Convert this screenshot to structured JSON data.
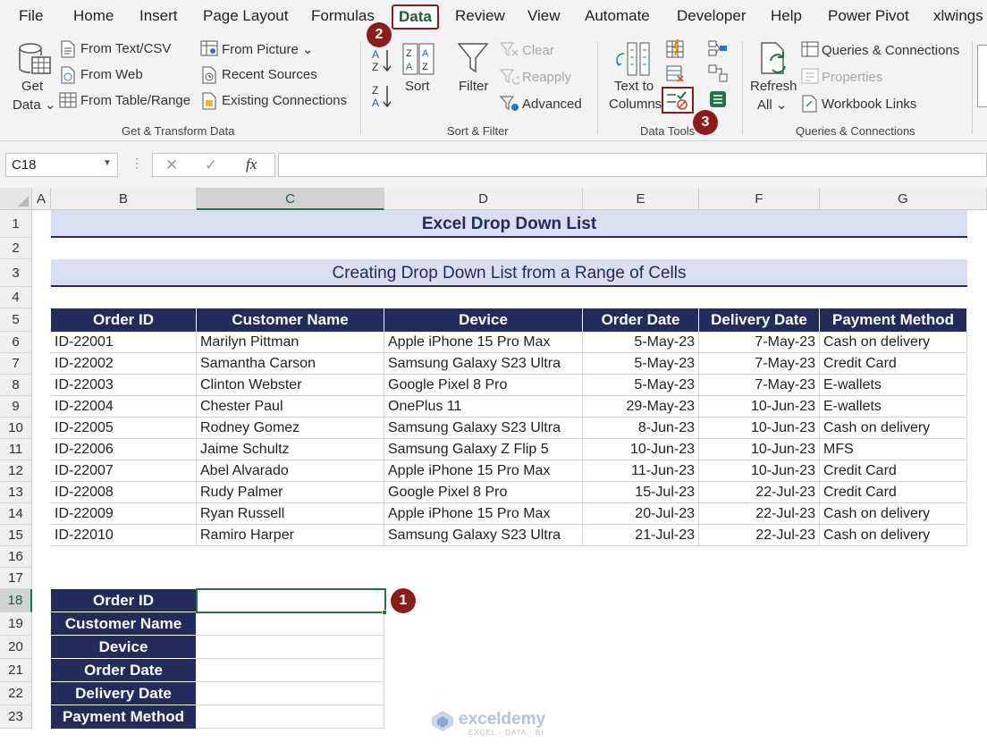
{
  "menu": [
    "File",
    "Home",
    "Insert",
    "Page Layout",
    "Formulas",
    "Data",
    "Review",
    "View",
    "Automate",
    "Developer",
    "Help",
    "Power Pivot",
    "xlwings"
  ],
  "ribbon": {
    "get_data": [
      "Get",
      "Data ⌄"
    ],
    "from_text_csv": "From Text/CSV",
    "from_web": "From Web",
    "from_table_range": "From Table/Range",
    "from_picture": "From Picture ⌄",
    "recent_sources": "Recent Sources",
    "existing_connections": "Existing Connections",
    "group_get_transform": "Get & Transform Data",
    "sort": "Sort",
    "filter": "Filter",
    "clear": "Clear",
    "reapply": "Reapply",
    "advanced": "Advanced",
    "group_sort_filter": "Sort & Filter",
    "text_to_columns": [
      "Text to",
      "Columns"
    ],
    "group_data_tools": "Data Tools",
    "refresh_all": [
      "Refresh",
      "All ⌄"
    ],
    "queries_connections": "Queries & Connections",
    "properties": "Properties",
    "workbook_links": "Workbook Links",
    "group_queries_connections": "Queries & Connections"
  },
  "formula_bar": {
    "name_box": "C18",
    "cancel": "✕",
    "enter": "✓",
    "fx": "fx",
    "value": ""
  },
  "columns": [
    "A",
    "B",
    "C",
    "D",
    "E",
    "F",
    "G"
  ],
  "rows": [
    "1",
    "2",
    "3",
    "4",
    "5",
    "6",
    "7",
    "8",
    "9",
    "10",
    "11",
    "12",
    "13",
    "14",
    "15",
    "16",
    "17",
    "18",
    "19",
    "20",
    "21",
    "22",
    "23"
  ],
  "sheet": {
    "title": "Excel Drop Down List",
    "subtitle": "Creating Drop Down List from a Range of Cells",
    "headers": [
      "Order ID",
      "Customer Name",
      "Device",
      "Order Date",
      "Delivery Date",
      "Payment Method"
    ],
    "data": [
      [
        "ID-22001",
        "Marilyn Pittman",
        "Apple iPhone 15 Pro Max",
        "5-May-23",
        "7-May-23",
        "Cash on delivery"
      ],
      [
        "ID-22002",
        "Samantha Carson",
        "Samsung Galaxy S23 Ultra",
        "5-May-23",
        "7-May-23",
        "Credit Card"
      ],
      [
        "ID-22003",
        "Clinton Webster",
        "Google Pixel 8 Pro",
        "5-May-23",
        "7-May-23",
        "E-wallets"
      ],
      [
        "ID-22004",
        "Chester Paul",
        "OnePlus 11",
        "29-May-23",
        "10-Jun-23",
        "E-wallets"
      ],
      [
        "ID-22005",
        "Rodney Gomez",
        "Samsung Galaxy S23 Ultra",
        "8-Jun-23",
        "10-Jun-23",
        "Cash on delivery"
      ],
      [
        "ID-22006",
        "Jaime Schultz",
        "Samsung Galaxy Z Flip 5",
        "10-Jun-23",
        "10-Jun-23",
        "MFS"
      ],
      [
        "ID-22007",
        "Abel Alvarado",
        "Apple iPhone 15 Pro Max",
        "11-Jun-23",
        "10-Jun-23",
        "Credit Card"
      ],
      [
        "ID-22008",
        "Rudy Palmer",
        "Google Pixel 8 Pro",
        "15-Jul-23",
        "22-Jul-23",
        "Credit Card"
      ],
      [
        "ID-22009",
        "Ryan Russell",
        "Apple iPhone 15 Pro Max",
        "20-Jul-23",
        "22-Jul-23",
        "Cash on delivery"
      ],
      [
        "ID-22010",
        "Ramiro Harper",
        "Samsung Galaxy S23 Ultra",
        "21-Jul-23",
        "22-Jul-23",
        "Cash on delivery"
      ]
    ],
    "form_labels": [
      "Order ID",
      "Customer Name",
      "Device",
      "Order Date",
      "Delivery Date",
      "Payment Method"
    ]
  },
  "badges": [
    "1",
    "2",
    "3"
  ],
  "watermark": {
    "name": "exceldemy",
    "tag": "EXCEL · DATA · BI"
  },
  "colors": {
    "header_bg": "#222b5c",
    "title_bg": "#d9dff0",
    "badge": "#8b1c1c",
    "accent_green": "#217346"
  }
}
